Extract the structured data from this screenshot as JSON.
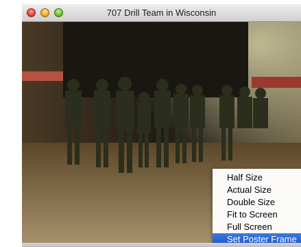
{
  "window": {
    "title": "707 Drill Team in Wisconsin"
  },
  "context_menu": {
    "items": [
      {
        "label": "Half Size",
        "selected": false
      },
      {
        "label": "Actual Size",
        "selected": false
      },
      {
        "label": "Double Size",
        "selected": false
      },
      {
        "label": "Fit to Screen",
        "selected": false
      },
      {
        "label": "Full Screen",
        "selected": false
      },
      {
        "label": "Set Poster Frame",
        "selected": true
      }
    ]
  },
  "colors": {
    "menu_highlight": "#2a63d6",
    "uniform": "#2b2e1c"
  }
}
